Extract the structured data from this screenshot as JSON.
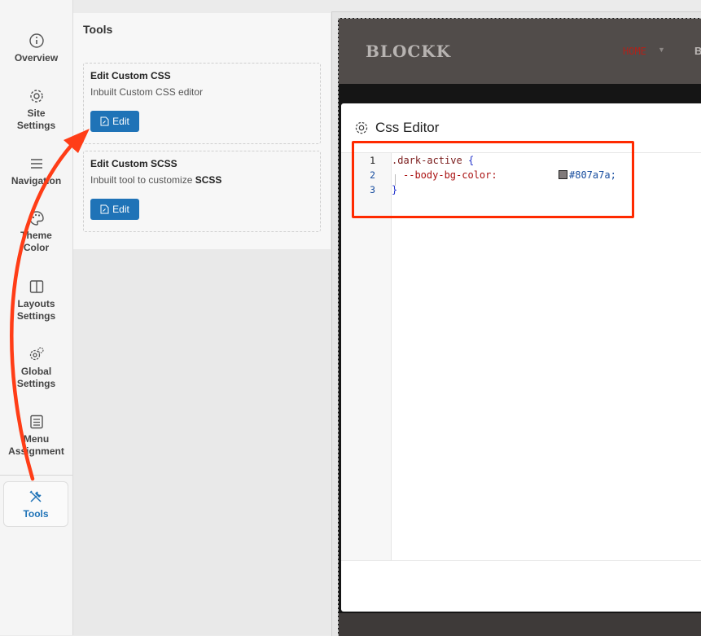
{
  "sidebar": {
    "items": [
      {
        "key": "overview",
        "label": "Overview",
        "icon": "info-icon"
      },
      {
        "key": "site-settings",
        "label": "Site Settings",
        "line1": "Site",
        "line2": "Settings",
        "icon": "gear-icon"
      },
      {
        "key": "navigation",
        "label": "Navigation",
        "icon": "menu-icon"
      },
      {
        "key": "theme-color",
        "label": "Theme Color",
        "line1": "Theme",
        "line2": "Color",
        "icon": "palette-icon"
      },
      {
        "key": "layouts-settings",
        "label": "Layouts Settings",
        "line1": "Layouts",
        "line2": "Settings",
        "icon": "layout-icon"
      },
      {
        "key": "global-settings",
        "label": "Global Settings",
        "line1": "Global",
        "line2": "Settings",
        "icon": "gears-icon"
      },
      {
        "key": "menu-assignment",
        "label": "Menu Assignment",
        "line1": "Menu",
        "line2": "Assignment",
        "icon": "list-icon"
      },
      {
        "key": "tools",
        "label": "Tools",
        "icon": "tools-icon",
        "active": true
      }
    ]
  },
  "tools": {
    "title": "Tools",
    "cards": [
      {
        "title": "Edit Custom CSS",
        "desc": "Inbuilt Custom CSS editor",
        "button": "Edit"
      },
      {
        "title": "Edit Custom SCSS",
        "desc_prefix": "Inbuilt tool to customize ",
        "desc_bold": "SCSS",
        "button": "Edit"
      }
    ]
  },
  "preview": {
    "brand": "BLOCKK",
    "nav_home": "HOME",
    "nav_next": "B"
  },
  "modal": {
    "title": "Css Editor",
    "line_numbers": [
      "1",
      "2",
      "3"
    ],
    "code": {
      "selector": ".dark-active",
      "open_brace": "{",
      "property": "--body-bg-color:",
      "value": "#807a7a;",
      "close_brace": "}"
    }
  },
  "colors": {
    "accent": "#1f73b7",
    "annotation": "#ff2a00",
    "swatch": "#807a7a",
    "site_header": "#514c4a",
    "nav_home": "#b0221a"
  }
}
